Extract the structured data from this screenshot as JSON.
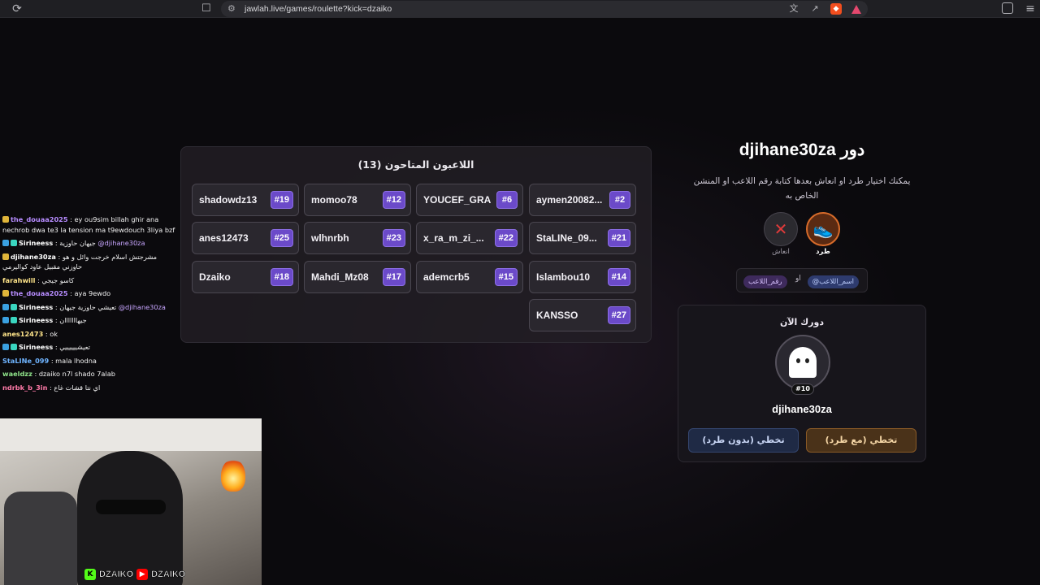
{
  "browser": {
    "url": "jawlah.live/games/roulette?kick=dzaiko",
    "reload_icon": "reload-icon",
    "bookmark_icon": "bookmark-icon"
  },
  "players": {
    "title": "اللاعبون المتاحون (13)",
    "list": [
      {
        "name": "aymen20082...",
        "num": "#2"
      },
      {
        "name": "YOUCEF_GRA",
        "num": "#6"
      },
      {
        "name": "momoo78",
        "num": "#12"
      },
      {
        "name": "shadowdz13",
        "num": "#19"
      },
      {
        "name": "StaLINe_09...",
        "num": "#21"
      },
      {
        "name": "x_ra_m_zi_...",
        "num": "#22"
      },
      {
        "name": "wlhnrbh",
        "num": "#23"
      },
      {
        "name": "anes12473",
        "num": "#25"
      },
      {
        "name": "Islambou10",
        "num": "#14"
      },
      {
        "name": "ademcrb5",
        "num": "#15"
      },
      {
        "name": "Mahdi_Mz08",
        "num": "#17"
      },
      {
        "name": "Dzaiko",
        "num": "#18"
      },
      {
        "name": "KANSSO",
        "num": "#27"
      }
    ]
  },
  "turn": {
    "title": "دور djihane30za",
    "description": "يمكنك اختيار طرد او انعاش بعدها كتابة رقم اللاعب او المنشن الخاص به",
    "kick_label": "طرد",
    "revive_label": "انعاش",
    "hint_name": "@اسم_اللاعب",
    "hint_or": "او",
    "hint_num": "رقم_اللاعب"
  },
  "current": {
    "label": "دورك الآن",
    "avatar_num": "#10",
    "name": "djihane30za",
    "skip_with_kick": "تخطي (مع طرد)",
    "skip_without_kick": "تخطي (بدون طرد)"
  },
  "chat": [
    {
      "user": "the_douaa2025",
      "text": ": ey ou9sim billah ghir ana nechrob dwa te3 la tension ma t9ewdouch 3liya bzf",
      "badges": [
        "yellow"
      ],
      "color": "purple"
    },
    {
      "user": "Sirineess",
      "text": ": جيهان حاوزية",
      "mention": "@djihane30za",
      "badges": [
        "blue",
        "cyan"
      ],
      "color": "white"
    },
    {
      "user": "djihane30za",
      "text": ": مشرجتش اسلام خرجت وائل و هو حاوزني مقبيل عاود كواليرمي",
      "badges": [
        "yellow"
      ],
      "color": "white"
    },
    {
      "user": "farahwill",
      "text": ": كاسو جيجي",
      "badges": [],
      "color": "yellow"
    },
    {
      "user": "the_douaa2025",
      "text": ": aya 9ewdo",
      "badges": [
        "yellow"
      ],
      "color": "purple"
    },
    {
      "user": "Sirineess",
      "text": ": تعيشي حاوزية جيهان",
      "mention": "@djihane30za",
      "badges": [
        "blue",
        "cyan"
      ],
      "color": "white"
    },
    {
      "user": "Sirineess",
      "text": ": جيهااااااان",
      "badges": [
        "blue",
        "cyan"
      ],
      "color": "white"
    },
    {
      "user": "anes12473",
      "text": ": ok",
      "badges": [],
      "color": "yellow"
    },
    {
      "user": "Sirineess",
      "text": ": تعيشييييييي",
      "badges": [
        "blue",
        "cyan"
      ],
      "color": "white"
    },
    {
      "user": "StaLINe_099",
      "text": ": mala lhodna",
      "badges": [],
      "color": "blue"
    },
    {
      "user": "waeldzz",
      "text": ": dzaiko n7l shado 7alab",
      "badges": [],
      "color": "green"
    },
    {
      "user": "ndrbk_b_3in",
      "text": ": اي نتا قشات غاع",
      "badges": [],
      "color": "pink"
    }
  ],
  "stream": {
    "kick_tag": "DZAIKO",
    "yt_tag": "DZAIKO"
  }
}
